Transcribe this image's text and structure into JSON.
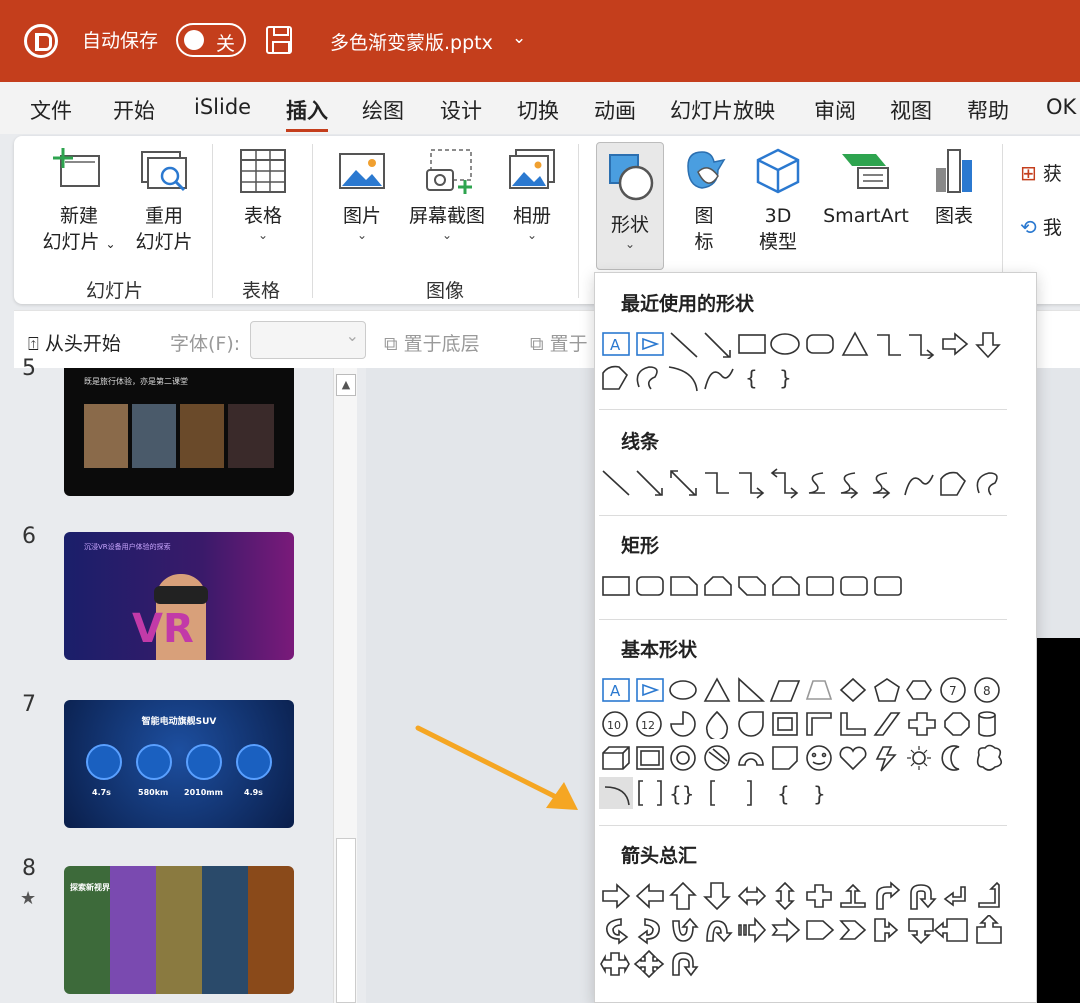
{
  "titlebar": {
    "autosave": "自动保存",
    "toggle": "关",
    "filename": "多色渐变蒙版.pptx",
    "chevron": "⌄"
  },
  "tabs": [
    {
      "label": "文件"
    },
    {
      "label": "开始"
    },
    {
      "label": "iSlide"
    },
    {
      "label": "插入"
    },
    {
      "label": "绘图"
    },
    {
      "label": "设计"
    },
    {
      "label": "切换"
    },
    {
      "label": "动画"
    },
    {
      "label": "幻灯片放映"
    },
    {
      "label": "审阅"
    },
    {
      "label": "视图"
    },
    {
      "label": "帮助"
    },
    {
      "label": "OK"
    }
  ],
  "active_tab": "插入",
  "ribbon": {
    "new_slide_1": "新建",
    "new_slide_2": "幻灯片",
    "reuse_1": "重用",
    "reuse_2": "幻灯片",
    "table": "表格",
    "picture": "图片",
    "screenshot": "屏幕截图",
    "album": "相册",
    "shapes": "形状",
    "icons_1": "图",
    "icons_2": "标",
    "model_1": "3D",
    "model_2": "模型",
    "smartart": "SmartArt",
    "chart": "图表",
    "get_addins": "获",
    "my_addins": "我",
    "groups": {
      "slides": "幻灯片",
      "tables": "表格",
      "images": "图像"
    }
  },
  "quickaccess": {
    "from_start": "从头开始",
    "font_label": "字体(F):",
    "send_back": "置于底层",
    "bring_front": "置于"
  },
  "slides": [
    {
      "number": "5",
      "title": "既是旅行体验，亦是第二课堂"
    },
    {
      "number": "6",
      "title": "沉浸VR设备用户体验的探索"
    },
    {
      "number": "7",
      "title": "智能电动旗舰SUV",
      "stats": [
        "4.7s",
        "580km",
        "2010mm",
        "4.9s"
      ]
    },
    {
      "number": "8",
      "star": "★",
      "title": "探索新视界"
    }
  ],
  "dropdown": {
    "recent": "最近使用的形状",
    "lines": "线条",
    "rectangles": "矩形",
    "basic": "基本形状",
    "arrows": "箭头总汇"
  },
  "colors": {
    "accent": "#c43e1c",
    "arrow": "#f5a623",
    "selection": "#2b79d0"
  }
}
